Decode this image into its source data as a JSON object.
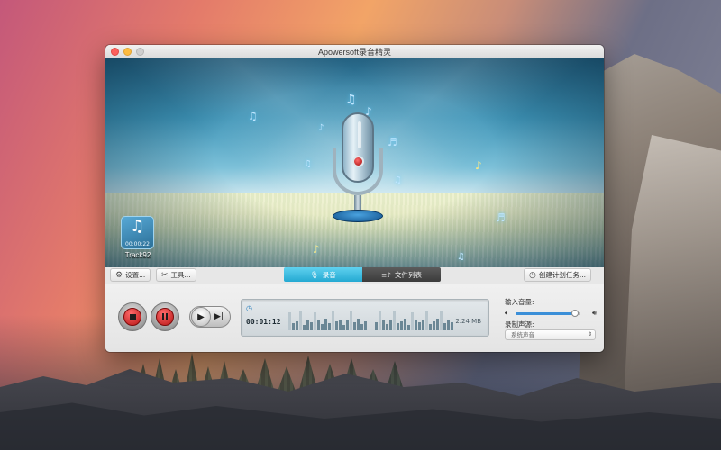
{
  "window": {
    "title": "Apowersoft录音精灵"
  },
  "scene": {
    "track": {
      "time": "00:00:22",
      "name": "Track92"
    },
    "icons": {
      "note": "music-note-icon",
      "microphone": "microphone-icon"
    }
  },
  "toolbar": {
    "settings_label": "设置...",
    "tools_label": "工具...",
    "tab_record": "录音",
    "tab_files": "文件列表",
    "schedule_label": "创建计划任务..."
  },
  "recorder": {
    "elapsed": "00:01:12",
    "file_size": "2.24 MB",
    "volume_label": "输入音量:",
    "volume_level": 0.92,
    "source_label": "录制声源:",
    "source_value": "系统声音"
  },
  "colors": {
    "accent": "#24a9d2",
    "record_red": "#b71414",
    "volume_blue": "#3b8fd8"
  }
}
